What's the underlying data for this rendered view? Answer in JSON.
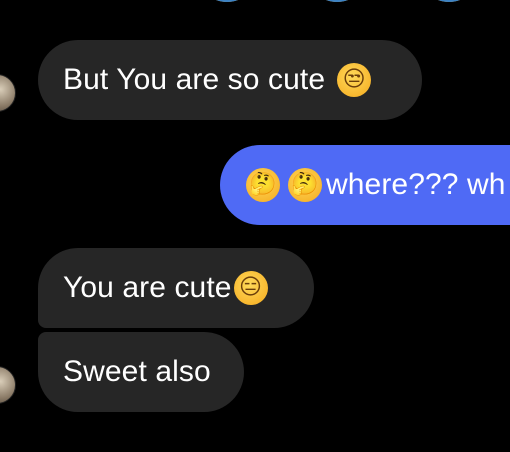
{
  "conversation": {
    "messages": [
      {
        "direction": "incoming",
        "text": "But You are so cute",
        "emoji": "unamused-face"
      },
      {
        "direction": "outgoing",
        "emoji_before": [
          "thinking-face",
          "thinking-face"
        ],
        "text": "where??? wh"
      },
      {
        "direction": "incoming",
        "text": "You are cute",
        "emoji": "expressionless-face"
      },
      {
        "direction": "incoming",
        "text": "Sweet also"
      }
    ]
  },
  "icons": {
    "unamused": "😒",
    "thinking": "🤔",
    "expressionless": "😑"
  },
  "colors": {
    "background": "#000000",
    "incoming_bubble": "#262626",
    "outgoing_bubble": "#4f6af5",
    "text": "#ffffff"
  }
}
